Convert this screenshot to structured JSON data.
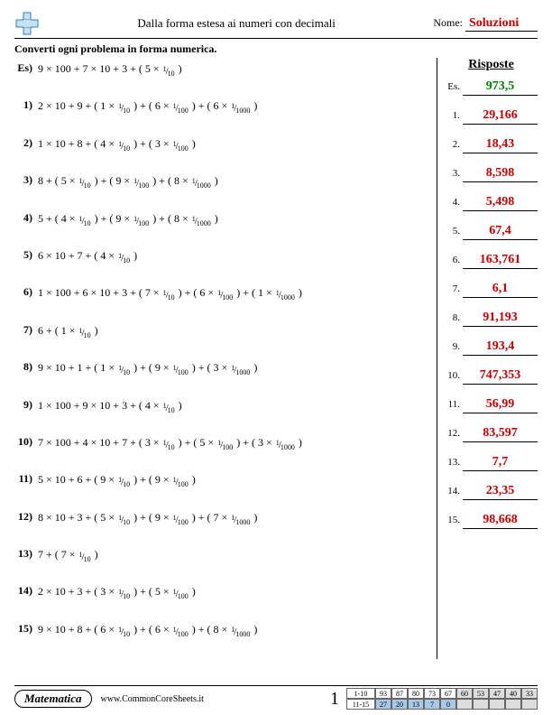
{
  "header": {
    "title": "Dalla forma estesa ai numeri con decimali",
    "name_label": "Nome:",
    "name_value": "Soluzioni"
  },
  "instruction": "Converti ogni problema in forma numerica.",
  "answers_title": "Risposte",
  "example_label": "Es)",
  "example_answer_label": "Es.",
  "problems": [
    {
      "num": "Es)",
      "parts": [
        "9 × 100 + 7 × 10 + 3 + ( 5 × ",
        {
          "n": "1",
          "d": "10"
        },
        " )"
      ]
    },
    {
      "num": "1)",
      "parts": [
        "2 × 10 + 9 + ( 1 × ",
        {
          "n": "1",
          "d": "10"
        },
        " ) + ( 6 × ",
        {
          "n": "1",
          "d": "100"
        },
        " ) + ( 6 × ",
        {
          "n": "1",
          "d": "1000"
        },
        " )"
      ]
    },
    {
      "num": "2)",
      "parts": [
        "1 × 10 + 8 + ( 4 × ",
        {
          "n": "1",
          "d": "10"
        },
        " ) + ( 3 × ",
        {
          "n": "1",
          "d": "100"
        },
        " )"
      ]
    },
    {
      "num": "3)",
      "parts": [
        "8 + ( 5 × ",
        {
          "n": "1",
          "d": "10"
        },
        " ) + ( 9 × ",
        {
          "n": "1",
          "d": "100"
        },
        " ) + ( 8 × ",
        {
          "n": "1",
          "d": "1000"
        },
        " )"
      ]
    },
    {
      "num": "4)",
      "parts": [
        "5 + ( 4 × ",
        {
          "n": "1",
          "d": "10"
        },
        " ) + ( 9 × ",
        {
          "n": "1",
          "d": "100"
        },
        " ) + ( 8 × ",
        {
          "n": "1",
          "d": "1000"
        },
        " )"
      ]
    },
    {
      "num": "5)",
      "parts": [
        "6 × 10 + 7 + ( 4 × ",
        {
          "n": "1",
          "d": "10"
        },
        " )"
      ]
    },
    {
      "num": "6)",
      "parts": [
        "1 × 100 + 6 × 10 + 3 + ( 7 × ",
        {
          "n": "1",
          "d": "10"
        },
        " ) + ( 6 × ",
        {
          "n": "1",
          "d": "100"
        },
        " ) + ( 1 × ",
        {
          "n": "1",
          "d": "1000"
        },
        " )"
      ]
    },
    {
      "num": "7)",
      "parts": [
        "6 + ( 1 × ",
        {
          "n": "1",
          "d": "10"
        },
        " )"
      ]
    },
    {
      "num": "8)",
      "parts": [
        "9 × 10 + 1 + ( 1 × ",
        {
          "n": "1",
          "d": "10"
        },
        " ) + ( 9 × ",
        {
          "n": "1",
          "d": "100"
        },
        " ) + ( 3 × ",
        {
          "n": "1",
          "d": "1000"
        },
        " )"
      ]
    },
    {
      "num": "9)",
      "parts": [
        "1 × 100 + 9 × 10 + 3 + ( 4 × ",
        {
          "n": "1",
          "d": "10"
        },
        " )"
      ]
    },
    {
      "num": "10)",
      "parts": [
        "7 × 100 + 4 × 10 + 7 + ( 3 × ",
        {
          "n": "1",
          "d": "10"
        },
        " ) + ( 5 × ",
        {
          "n": "1",
          "d": "100"
        },
        " ) + ( 3 × ",
        {
          "n": "1",
          "d": "1000"
        },
        " )"
      ]
    },
    {
      "num": "11)",
      "parts": [
        "5 × 10 + 6 + ( 9 × ",
        {
          "n": "1",
          "d": "10"
        },
        " ) + ( 9 × ",
        {
          "n": "1",
          "d": "100"
        },
        " )"
      ]
    },
    {
      "num": "12)",
      "parts": [
        "8 × 10 + 3 + ( 5 × ",
        {
          "n": "1",
          "d": "10"
        },
        " ) + ( 9 × ",
        {
          "n": "1",
          "d": "100"
        },
        " ) + ( 7 × ",
        {
          "n": "1",
          "d": "1000"
        },
        " )"
      ]
    },
    {
      "num": "13)",
      "parts": [
        "7 + ( 7 × ",
        {
          "n": "1",
          "d": "10"
        },
        " )"
      ]
    },
    {
      "num": "14)",
      "parts": [
        "2 × 10 + 3 + ( 3 × ",
        {
          "n": "1",
          "d": "10"
        },
        " ) + ( 5 × ",
        {
          "n": "1",
          "d": "100"
        },
        " )"
      ]
    },
    {
      "num": "15)",
      "parts": [
        "9 × 10 + 8 + ( 6 × ",
        {
          "n": "1",
          "d": "10"
        },
        " ) + ( 6 × ",
        {
          "n": "1",
          "d": "100"
        },
        " ) + ( 8 × ",
        {
          "n": "1",
          "d": "1000"
        },
        " )"
      ]
    }
  ],
  "answers": [
    {
      "label": "Es.",
      "value": "973,5",
      "example": true
    },
    {
      "label": "1.",
      "value": "29,166"
    },
    {
      "label": "2.",
      "value": "18,43"
    },
    {
      "label": "3.",
      "value": "8,598"
    },
    {
      "label": "4.",
      "value": "5,498"
    },
    {
      "label": "5.",
      "value": "67,4"
    },
    {
      "label": "6.",
      "value": "163,761"
    },
    {
      "label": "7.",
      "value": "6,1"
    },
    {
      "label": "8.",
      "value": "91,193"
    },
    {
      "label": "9.",
      "value": "193,4"
    },
    {
      "label": "10.",
      "value": "747,353"
    },
    {
      "label": "11.",
      "value": "56,99"
    },
    {
      "label": "12.",
      "value": "83,597"
    },
    {
      "label": "13.",
      "value": "7,7"
    },
    {
      "label": "14.",
      "value": "23,35"
    },
    {
      "label": "15.",
      "value": "98,668"
    }
  ],
  "footer": {
    "subject": "Matematica",
    "website": "www.CommonCoreSheets.it",
    "page": "1",
    "score": {
      "row1_label": "1-10",
      "row2_label": "11-15",
      "row1": [
        "93",
        "87",
        "80",
        "73",
        "67",
        "60",
        "53",
        "47",
        "40",
        "33"
      ],
      "row2": [
        "27",
        "20",
        "13",
        "7",
        "0"
      ]
    }
  }
}
